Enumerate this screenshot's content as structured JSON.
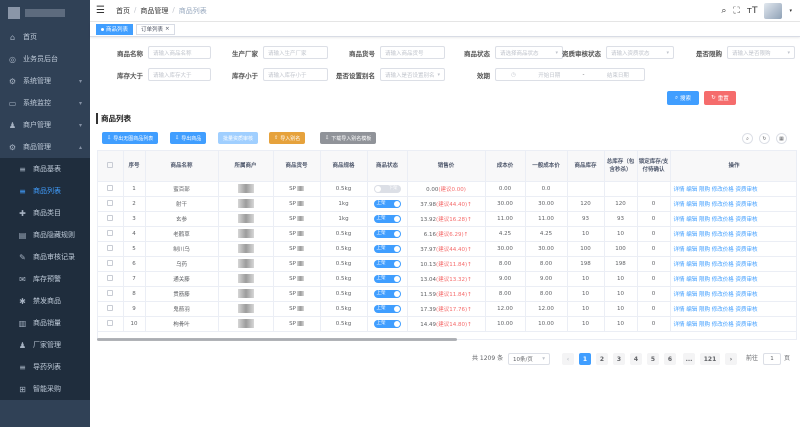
{
  "sidebar": {
    "items": [
      {
        "label": "首页",
        "icon": "home-icon"
      },
      {
        "label": "业务员后台",
        "icon": "globe-icon"
      },
      {
        "label": "系统管理",
        "icon": "gear-icon",
        "arrow": true
      },
      {
        "label": "系统监控",
        "icon": "monitor-icon",
        "arrow": true
      },
      {
        "label": "商户管理",
        "icon": "user-icon",
        "arrow": true
      },
      {
        "label": "商品管理",
        "icon": "gear-icon",
        "arrow": true,
        "open": true
      }
    ],
    "sub_items": [
      {
        "label": "商品基表",
        "icon": "list-icon"
      },
      {
        "label": "商品列表",
        "icon": "list-icon",
        "active": true
      },
      {
        "label": "商品类目",
        "icon": "plus-icon"
      },
      {
        "label": "商品隐藏规则",
        "icon": "doc-icon"
      },
      {
        "label": "商品审核记录",
        "icon": "edit-icon"
      },
      {
        "label": "库存预警",
        "icon": "chat-icon"
      },
      {
        "label": "禁发商品",
        "icon": "bug-icon"
      },
      {
        "label": "商品销量",
        "icon": "chart-icon"
      },
      {
        "label": "厂家管理",
        "icon": "user-icon"
      },
      {
        "label": "导药列表",
        "icon": "list-icon"
      },
      {
        "label": "智能采购",
        "icon": "cart-icon"
      }
    ]
  },
  "breadcrumb": [
    "首页",
    "商品管理",
    "商品列表"
  ],
  "tabs": [
    {
      "label": "商品列表",
      "active": true
    },
    {
      "label": "订单列表"
    }
  ],
  "form": {
    "fields": [
      {
        "label": "商品名称",
        "placeholder": "请输入商品名称"
      },
      {
        "label": "生产厂家",
        "placeholder": "请输入生产厂家"
      },
      {
        "label": "商品货号",
        "placeholder": "请输入商品货号"
      },
      {
        "label": "商品状态",
        "placeholder": "请选择商品状态"
      },
      {
        "label": "资质审核状态",
        "placeholder": "请输入资质状态"
      },
      {
        "label": "是否限购",
        "placeholder": "请输入是否限购"
      },
      {
        "label": "库存大于",
        "placeholder": "请输入库存大于"
      },
      {
        "label": "库存小于",
        "placeholder": "请输入库存小于"
      },
      {
        "label": "是否设置别名",
        "placeholder": "请输入是否设置别名"
      },
      {
        "label": "效期",
        "placeholder": "开始日期",
        "placeholder2": "结束日期",
        "sep": "-"
      }
    ],
    "search_label": "搜索",
    "reset_label": "重置"
  },
  "section_title": "商品列表",
  "toolbar": {
    "export_no_img": "导出无图商品列表",
    "export": "导出商品",
    "batch_audit": "批量资质审核",
    "import_alias": "导入别名",
    "download_tpl": "下载导入别名模板"
  },
  "table": {
    "headers": [
      "",
      "序号",
      "商品名称",
      "所属商户",
      "商品货号",
      "商品规格",
      "商品状态",
      "销售价",
      "成本价",
      "一般成本价",
      "商品库存",
      "总库存（包含秒杀）",
      "锁定库存/支付待确认",
      "操作"
    ],
    "rows": [
      {
        "no": "1",
        "name": "蜜百部",
        "sku": "SP",
        "spec": "0.5kg",
        "on": false,
        "status": "下架",
        "price": "0.00",
        "advice": "(建议0.00)",
        "arrow": "",
        "cost": "0.00",
        "gcost": "0.0",
        "stock": "",
        "total": "",
        "lock": ""
      },
      {
        "no": "2",
        "name": "射干",
        "sku": "SP",
        "spec": "1kg",
        "on": true,
        "status": "上架",
        "price": "37.98",
        "advice": "(建议44.40)",
        "arrow": "↑",
        "cost": "30.00",
        "gcost": "30.00",
        "stock": "120",
        "total": "120",
        "lock": "0"
      },
      {
        "no": "3",
        "name": "玄参",
        "sku": "SP",
        "spec": "1kg",
        "on": true,
        "status": "上架",
        "price": "13.92",
        "advice": "(建议16.28)",
        "arrow": "↑",
        "cost": "11.00",
        "gcost": "11.00",
        "stock": "93",
        "total": "93",
        "lock": "0"
      },
      {
        "no": "4",
        "name": "老鹳草",
        "sku": "SP",
        "spec": "0.5kg",
        "on": true,
        "status": "上架",
        "price": "6.16",
        "advice": "(建议6.29)",
        "arrow": "↑",
        "cost": "4.25",
        "gcost": "4.25",
        "stock": "10",
        "total": "10",
        "lock": "0"
      },
      {
        "no": "5",
        "name": "制川乌",
        "sku": "SP",
        "spec": "0.5kg",
        "on": true,
        "status": "上架",
        "price": "37.97",
        "advice": "(建议44.40)",
        "arrow": "↑",
        "cost": "30.00",
        "gcost": "30.00",
        "stock": "100",
        "total": "100",
        "lock": "0"
      },
      {
        "no": "6",
        "name": "乌药",
        "sku": "SP",
        "spec": "0.5kg",
        "on": true,
        "status": "上架",
        "price": "10.13",
        "advice": "(建议11.84)",
        "arrow": "↑",
        "cost": "8.00",
        "gcost": "8.00",
        "stock": "198",
        "total": "198",
        "lock": "0"
      },
      {
        "no": "7",
        "name": "通关藤",
        "sku": "SP",
        "spec": "0.5kg",
        "on": true,
        "status": "上架",
        "price": "13.04",
        "advice": "(建议13.32)",
        "arrow": "↑",
        "cost": "9.00",
        "gcost": "9.00",
        "stock": "10",
        "total": "10",
        "lock": "0"
      },
      {
        "no": "8",
        "name": "贯筋藤",
        "sku": "SP",
        "spec": "0.5kg",
        "on": true,
        "status": "上架",
        "price": "11.59",
        "advice": "(建议11.84)",
        "arrow": "↑",
        "cost": "8.00",
        "gcost": "8.00",
        "stock": "10",
        "total": "10",
        "lock": "0"
      },
      {
        "no": "9",
        "name": "鬼箭羽",
        "sku": "SP",
        "spec": "0.5kg",
        "on": true,
        "status": "上架",
        "price": "17.39",
        "advice": "(建议17.76)",
        "arrow": "↑",
        "cost": "12.00",
        "gcost": "12.00",
        "stock": "10",
        "total": "10",
        "lock": "0"
      },
      {
        "no": "10",
        "name": "枸骨叶",
        "sku": "SP",
        "spec": "0.5kg",
        "on": true,
        "status": "上架",
        "price": "14.49",
        "advice": "(建议14.80)",
        "arrow": "↑",
        "cost": "10.00",
        "gcost": "10.00",
        "stock": "10",
        "total": "10",
        "lock": "0"
      }
    ],
    "ops": "详情 编辑 限购 修改价格 资质审核"
  },
  "pagination": {
    "total": "共 1209 条",
    "page_size": "10条/页",
    "pages": [
      "1",
      "2",
      "3",
      "4",
      "5",
      "6",
      "...",
      "121"
    ],
    "goto_label": "前往",
    "goto_value": "1",
    "goto_suffix": "页"
  },
  "colors": {
    "primary": "#409eff",
    "danger": "#f56c6c",
    "warning": "#e6a23c",
    "info": "#909399",
    "sidebar": "#304156"
  }
}
